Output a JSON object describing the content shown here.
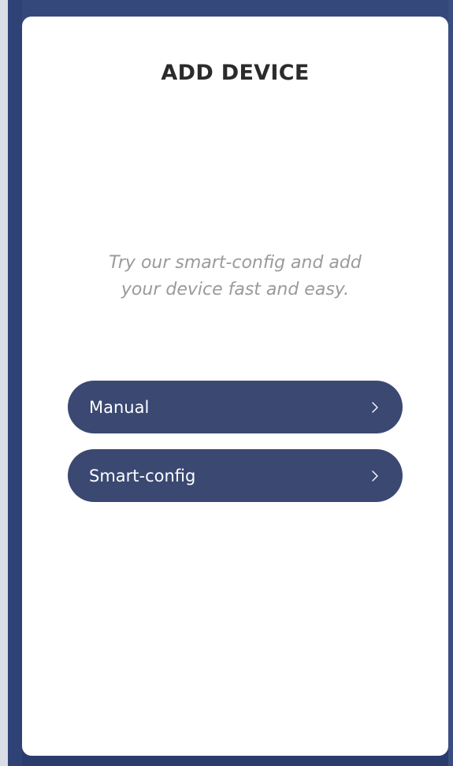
{
  "card": {
    "title": "ADD DEVICE",
    "description_lines": [
      "Try our smart-config and add",
      "your device fast and easy."
    ]
  },
  "options": [
    {
      "label": "Manual",
      "icon": "chevron-right-icon"
    },
    {
      "label": "Smart-config",
      "icon": "chevron-right-icon"
    }
  ],
  "colors": {
    "backdrop": "#2c3f72",
    "card": "#ffffff",
    "button": "#3a4872",
    "title": "#2b2b2b",
    "description": "#9a9a9a"
  }
}
